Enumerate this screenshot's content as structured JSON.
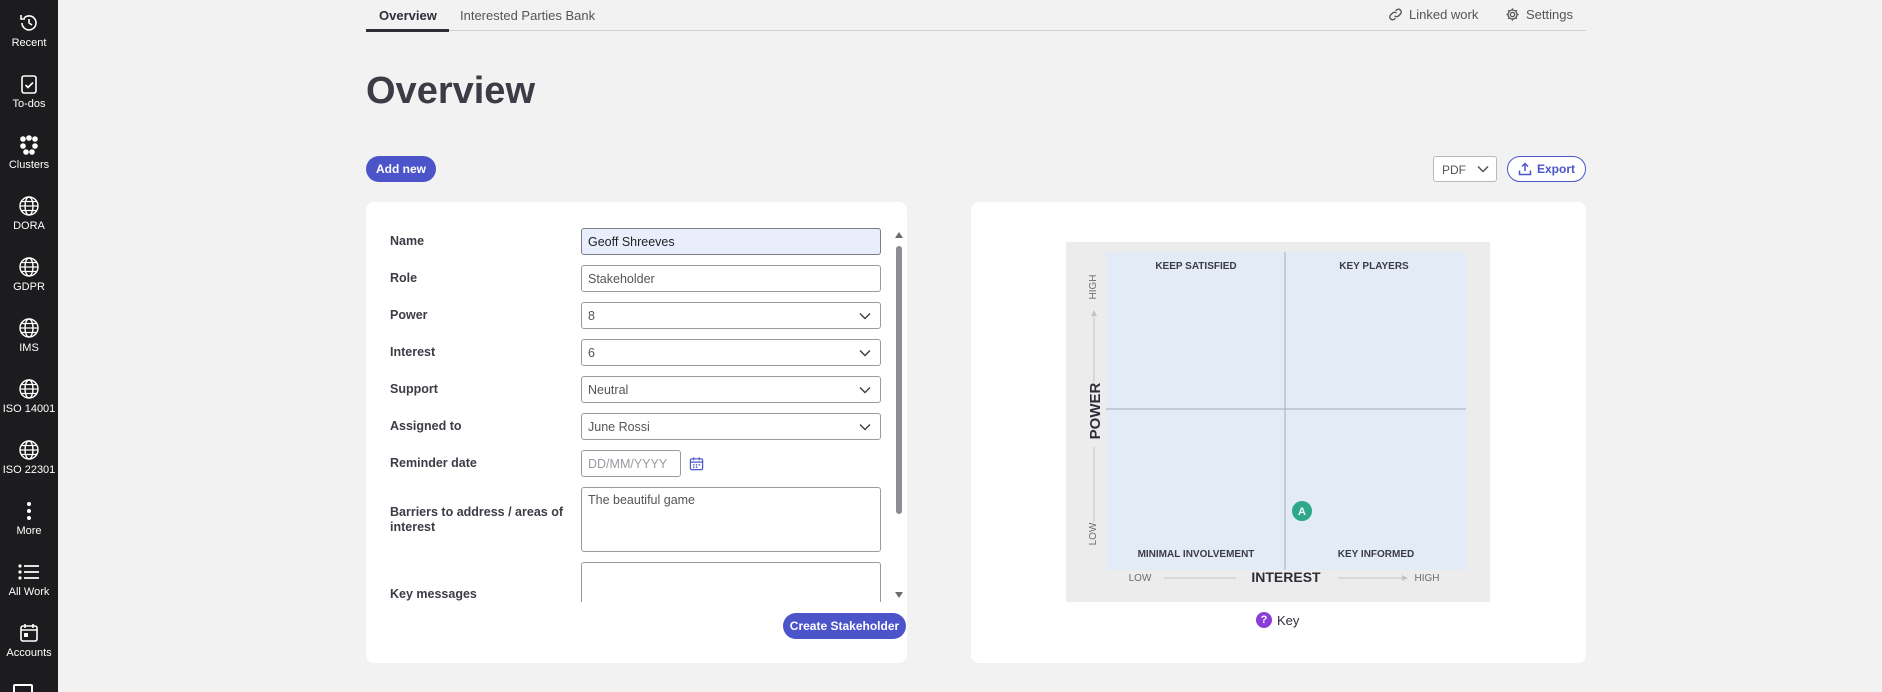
{
  "rail": {
    "items": [
      {
        "label": "Recent",
        "icon": "history-icon"
      },
      {
        "label": "To-dos",
        "icon": "clipboard-check-icon"
      },
      {
        "label": "Clusters",
        "icon": "clusters-icon"
      },
      {
        "label": "DORA",
        "icon": "globe-icon"
      },
      {
        "label": "GDPR",
        "icon": "globe-icon"
      },
      {
        "label": "IMS",
        "icon": "globe-icon"
      },
      {
        "label": "ISO 14001",
        "icon": "globe-icon"
      },
      {
        "label": "ISO 22301",
        "icon": "globe-icon"
      },
      {
        "label": "More",
        "icon": "more-vertical-icon"
      },
      {
        "label": "All Work",
        "icon": "list-icon"
      },
      {
        "label": "Accounts",
        "icon": "calendar-icon"
      }
    ]
  },
  "tabs": {
    "overview": "Overview",
    "interested_parties": "Interested Parties Bank",
    "linked_work": "Linked work",
    "settings": "Settings"
  },
  "page": {
    "title": "Overview",
    "add_new": "Add new",
    "format_select": "PDF",
    "export": "Export"
  },
  "form": {
    "name_label": "Name",
    "name_value": "Geoff Shreeves",
    "role_label": "Role",
    "role_value": "Stakeholder",
    "power_label": "Power",
    "power_value": "8",
    "interest_label": "Interest",
    "interest_value": "6",
    "support_label": "Support",
    "support_value": "Neutral",
    "assigned_label": "Assigned to",
    "assigned_value": "June Rossi",
    "reminder_label": "Reminder date",
    "reminder_placeholder": "DD/MM/YYYY",
    "barriers_label": "Barriers to address / areas of interest",
    "barriers_value": "The beautiful game",
    "key_messages_label": "Key messages",
    "key_messages_value": "",
    "create_button": "Create Stakeholder"
  },
  "matrix": {
    "quadrants": {
      "top_left": "KEEP SATISFIED",
      "top_right": "KEY PLAYERS",
      "bottom_left": "MINIMAL INVOLVEMENT",
      "bottom_right": "KEY INFORMED"
    },
    "y_axis": {
      "label": "POWER",
      "high": "HIGH",
      "low": "LOW"
    },
    "x_axis": {
      "label": "INTEREST",
      "high": "HIGH",
      "low": "LOW"
    },
    "marker_label": "A",
    "key_label": "Key",
    "colors": {
      "quadrant": "#e3ebf6",
      "frame": "#ececec",
      "marker": "#2fa88a",
      "accent": "#4b55c9"
    }
  }
}
